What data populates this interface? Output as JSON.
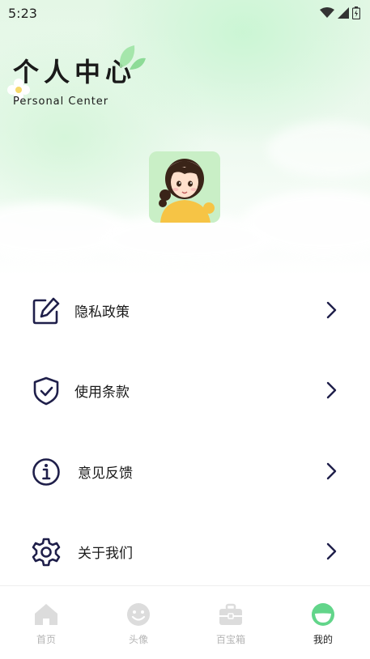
{
  "status_bar": {
    "time": "5:23"
  },
  "header": {
    "title": "个人中心",
    "subtitle": "Personal Center"
  },
  "menu": {
    "items": [
      {
        "label": "隐私政策",
        "icon": "edit-icon"
      },
      {
        "label": "使用条款",
        "icon": "shield-check-icon"
      },
      {
        "label": "意见反馈",
        "icon": "info-icon"
      },
      {
        "label": "关于我们",
        "icon": "gear-icon"
      }
    ]
  },
  "tabbar": {
    "tabs": [
      {
        "label": "首页",
        "icon": "home-icon",
        "active": false
      },
      {
        "label": "头像",
        "icon": "smiley-icon",
        "active": false
      },
      {
        "label": "百宝箱",
        "icon": "toolbox-icon",
        "active": false
      },
      {
        "label": "我的",
        "icon": "profile-icon",
        "active": true
      }
    ]
  },
  "colors": {
    "accent": "#62d58a",
    "icon_stroke": "#1f1f4a",
    "inactive": "#b4b4b4"
  }
}
